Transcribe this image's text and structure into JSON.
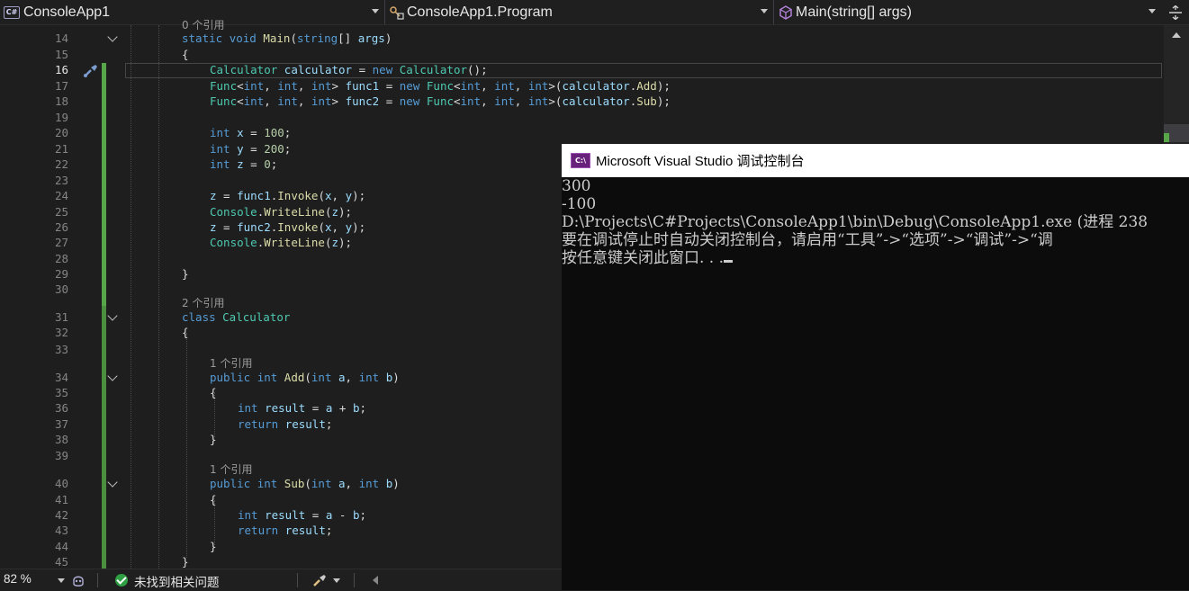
{
  "nav": {
    "project": "ConsoleApp1",
    "class_path": "ConsoleApp1.Program",
    "member": "Main(string[] args)"
  },
  "editor": {
    "lens_top": "0 个引用",
    "lines": [
      {
        "n": "14",
        "segs": [
          [
            "kw",
            "static "
          ],
          [
            "kw",
            "void "
          ],
          [
            "mt",
            "Main"
          ],
          [
            "pu",
            "("
          ],
          [
            "kw",
            "string"
          ],
          [
            "pu",
            "[] "
          ],
          [
            "vr",
            "args"
          ],
          [
            "pu",
            ")"
          ]
        ]
      },
      {
        "n": "15",
        "segs": [
          [
            "pu",
            "{"
          ]
        ]
      },
      {
        "n": "16",
        "segs": [
          [
            "ty",
            "Calculator "
          ],
          [
            "vr",
            "calculator"
          ],
          [
            "pu",
            " = "
          ],
          [
            "kw",
            "new "
          ],
          [
            "ty",
            "Calculator"
          ],
          [
            "pu",
            "();"
          ]
        ]
      },
      {
        "n": "17",
        "segs": [
          [
            "ty",
            "Func"
          ],
          [
            "pu",
            "<"
          ],
          [
            "kw",
            "int"
          ],
          [
            "pu",
            ", "
          ],
          [
            "kw",
            "int"
          ],
          [
            "pu",
            ", "
          ],
          [
            "kw",
            "int"
          ],
          [
            "pu",
            "> "
          ],
          [
            "vr",
            "func1"
          ],
          [
            "pu",
            " = "
          ],
          [
            "kw",
            "new "
          ],
          [
            "ty",
            "Func"
          ],
          [
            "pu",
            "<"
          ],
          [
            "kw",
            "int"
          ],
          [
            "pu",
            ", "
          ],
          [
            "kw",
            "int"
          ],
          [
            "pu",
            ", "
          ],
          [
            "kw",
            "int"
          ],
          [
            "pu",
            ">("
          ],
          [
            "vr",
            "calculator"
          ],
          [
            "pu",
            "."
          ],
          [
            "mt",
            "Add"
          ],
          [
            "pu",
            ");"
          ]
        ]
      },
      {
        "n": "18",
        "segs": [
          [
            "ty",
            "Func"
          ],
          [
            "pu",
            "<"
          ],
          [
            "kw",
            "int"
          ],
          [
            "pu",
            ", "
          ],
          [
            "kw",
            "int"
          ],
          [
            "pu",
            ", "
          ],
          [
            "kw",
            "int"
          ],
          [
            "pu",
            "> "
          ],
          [
            "vr",
            "func2"
          ],
          [
            "pu",
            " = "
          ],
          [
            "kw",
            "new "
          ],
          [
            "ty",
            "Func"
          ],
          [
            "pu",
            "<"
          ],
          [
            "kw",
            "int"
          ],
          [
            "pu",
            ", "
          ],
          [
            "kw",
            "int"
          ],
          [
            "pu",
            ", "
          ],
          [
            "kw",
            "int"
          ],
          [
            "pu",
            ">("
          ],
          [
            "vr",
            "calculator"
          ],
          [
            "pu",
            "."
          ],
          [
            "mt",
            "Sub"
          ],
          [
            "pu",
            ");"
          ]
        ]
      },
      {
        "n": "19",
        "segs": []
      },
      {
        "n": "20",
        "segs": [
          [
            "kw",
            "int "
          ],
          [
            "vr",
            "x"
          ],
          [
            "pu",
            " = "
          ],
          [
            "nu",
            "100"
          ],
          [
            "pu",
            ";"
          ]
        ]
      },
      {
        "n": "21",
        "segs": [
          [
            "kw",
            "int "
          ],
          [
            "vr",
            "y"
          ],
          [
            "pu",
            " = "
          ],
          [
            "nu",
            "200"
          ],
          [
            "pu",
            ";"
          ]
        ]
      },
      {
        "n": "22",
        "segs": [
          [
            "kw",
            "int "
          ],
          [
            "vr",
            "z"
          ],
          [
            "pu",
            " = "
          ],
          [
            "nu",
            "0"
          ],
          [
            "pu",
            ";"
          ]
        ]
      },
      {
        "n": "23",
        "segs": []
      },
      {
        "n": "24",
        "segs": [
          [
            "vr",
            "z"
          ],
          [
            "pu",
            " = "
          ],
          [
            "vr",
            "func1"
          ],
          [
            "pu",
            "."
          ],
          [
            "mt",
            "Invoke"
          ],
          [
            "pu",
            "("
          ],
          [
            "vr",
            "x"
          ],
          [
            "pu",
            ", "
          ],
          [
            "vr",
            "y"
          ],
          [
            "pu",
            ");"
          ]
        ]
      },
      {
        "n": "25",
        "segs": [
          [
            "ty",
            "Console"
          ],
          [
            "pu",
            "."
          ],
          [
            "mt",
            "WriteLine"
          ],
          [
            "pu",
            "("
          ],
          [
            "vr",
            "z"
          ],
          [
            "pu",
            ");"
          ]
        ]
      },
      {
        "n": "26",
        "segs": [
          [
            "vr",
            "z"
          ],
          [
            "pu",
            " = "
          ],
          [
            "vr",
            "func2"
          ],
          [
            "pu",
            "."
          ],
          [
            "mt",
            "Invoke"
          ],
          [
            "pu",
            "("
          ],
          [
            "vr",
            "x"
          ],
          [
            "pu",
            ", "
          ],
          [
            "vr",
            "y"
          ],
          [
            "pu",
            ");"
          ]
        ]
      },
      {
        "n": "27",
        "segs": [
          [
            "ty",
            "Console"
          ],
          [
            "pu",
            "."
          ],
          [
            "mt",
            "WriteLine"
          ],
          [
            "pu",
            "("
          ],
          [
            "vr",
            "z"
          ],
          [
            "pu",
            ");"
          ]
        ]
      },
      {
        "n": "28",
        "segs": []
      },
      {
        "n": "29",
        "segs": [
          [
            "pu",
            "}"
          ]
        ]
      },
      {
        "n": "30",
        "segs": []
      },
      {
        "n": "31",
        "segs": [
          [
            "kw",
            "class "
          ],
          [
            "ty",
            "Calculator"
          ]
        ]
      },
      {
        "n": "32",
        "segs": [
          [
            "pu",
            "{"
          ]
        ]
      },
      {
        "n": "33",
        "segs": []
      },
      {
        "n": "34",
        "segs": [
          [
            "kw",
            "public "
          ],
          [
            "kw",
            "int "
          ],
          [
            "mt",
            "Add"
          ],
          [
            "pu",
            "("
          ],
          [
            "kw",
            "int "
          ],
          [
            "vr",
            "a"
          ],
          [
            "pu",
            ", "
          ],
          [
            "kw",
            "int "
          ],
          [
            "vr",
            "b"
          ],
          [
            "pu",
            ")"
          ]
        ]
      },
      {
        "n": "35",
        "segs": [
          [
            "pu",
            "{"
          ]
        ]
      },
      {
        "n": "36",
        "segs": [
          [
            "kw",
            "int "
          ],
          [
            "vr",
            "result"
          ],
          [
            "pu",
            " = "
          ],
          [
            "vr",
            "a"
          ],
          [
            "pu",
            " + "
          ],
          [
            "vr",
            "b"
          ],
          [
            "pu",
            ";"
          ]
        ]
      },
      {
        "n": "37",
        "segs": [
          [
            "kw",
            "return "
          ],
          [
            "vr",
            "result"
          ],
          [
            "pu",
            ";"
          ]
        ]
      },
      {
        "n": "38",
        "segs": [
          [
            "pu",
            "}"
          ]
        ]
      },
      {
        "n": "39",
        "segs": []
      },
      {
        "n": "40",
        "segs": [
          [
            "kw",
            "public "
          ],
          [
            "kw",
            "int "
          ],
          [
            "mt",
            "Sub"
          ],
          [
            "pu",
            "("
          ],
          [
            "kw",
            "int "
          ],
          [
            "vr",
            "a"
          ],
          [
            "pu",
            ", "
          ],
          [
            "kw",
            "int "
          ],
          [
            "vr",
            "b"
          ],
          [
            "pu",
            ")"
          ]
        ]
      },
      {
        "n": "41",
        "segs": [
          [
            "pu",
            "{"
          ]
        ]
      },
      {
        "n": "42",
        "segs": [
          [
            "kw",
            "int "
          ],
          [
            "vr",
            "result"
          ],
          [
            "pu",
            " = "
          ],
          [
            "vr",
            "a"
          ],
          [
            "pu",
            " - "
          ],
          [
            "vr",
            "b"
          ],
          [
            "pu",
            ";"
          ]
        ]
      },
      {
        "n": "43",
        "segs": [
          [
            "kw",
            "return "
          ],
          [
            "vr",
            "result"
          ],
          [
            "pu",
            ";"
          ]
        ]
      },
      {
        "n": "44",
        "segs": [
          [
            "pu",
            "}"
          ]
        ]
      },
      {
        "n": "45",
        "segs": [
          [
            "pu",
            "}"
          ]
        ]
      }
    ],
    "lens_class": "2 个引用",
    "lens_add": "1 个引用",
    "lens_sub": "1 个引用"
  },
  "console": {
    "title": "Microsoft Visual Studio 调试控制台",
    "lines": [
      "300",
      "-100",
      "",
      "D:\\Projects\\C#Projects\\ConsoleApp1\\bin\\Debug\\ConsoleApp1.exe (进程 238",
      "要在调试停止时自动关闭控制台，请启用“工具”->“选项”->“调试”->“调",
      "按任意键关闭此窗口. . ."
    ]
  },
  "status": {
    "zoom": "82 %",
    "issues": "未找到相关问题"
  }
}
